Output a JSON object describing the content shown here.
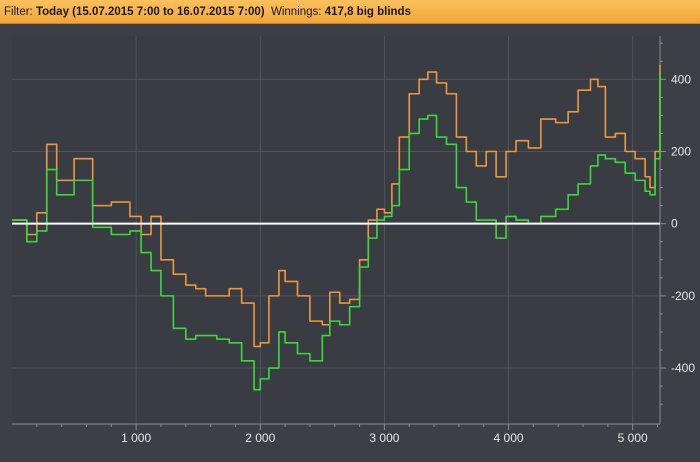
{
  "header": {
    "filter_label": "Filter:",
    "filter_value": "Today (15.07.2015 7:00 to 16.07.2015 7:00)",
    "winnings_label": "Winnings:",
    "winnings_value": "417,8 big blinds"
  },
  "chart_data": {
    "type": "line",
    "x_ticks": [
      1000,
      2000,
      3000,
      4000,
      5000
    ],
    "x_tick_labels": [
      "1 000",
      "2 000",
      "3 000",
      "4 000",
      "5 000"
    ],
    "y_ticks": [
      400,
      200,
      0,
      -200,
      -400
    ],
    "y_tick_labels": [
      "400",
      "200",
      "0",
      "-200",
      "-400"
    ],
    "xlim": [
      0,
      5220
    ],
    "ylim": [
      -555,
      520
    ],
    "grid": true,
    "zero_line": true,
    "series": [
      {
        "color": "#f0963c",
        "x": [
          0,
          120,
          200,
          280,
          360,
          500,
          650,
          800,
          950,
          1040,
          1120,
          1200,
          1300,
          1400,
          1480,
          1560,
          1650,
          1750,
          1850,
          1950,
          2000,
          2070,
          2150,
          2200,
          2300,
          2400,
          2500,
          2560,
          2640,
          2720,
          2800,
          2870,
          2940,
          3000,
          3060,
          3120,
          3200,
          3280,
          3350,
          3420,
          3500,
          3580,
          3660,
          3740,
          3820,
          3900,
          3980,
          4060,
          4160,
          4260,
          4380,
          4480,
          4560,
          4660,
          4720,
          4780,
          4860,
          4940,
          5020,
          5100,
          5140,
          5180,
          5220
        ],
        "y": [
          10,
          -30,
          30,
          220,
          120,
          180,
          50,
          60,
          20,
          -30,
          20,
          -100,
          -140,
          -170,
          -180,
          -200,
          -200,
          -180,
          -220,
          -340,
          -330,
          -200,
          -130,
          -160,
          -200,
          -270,
          -280,
          -190,
          -220,
          -210,
          -100,
          10,
          40,
          30,
          110,
          240,
          360,
          400,
          420,
          390,
          360,
          240,
          200,
          160,
          200,
          130,
          200,
          230,
          210,
          290,
          280,
          310,
          370,
          400,
          380,
          240,
          250,
          200,
          180,
          130,
          100,
          200,
          440
        ]
      },
      {
        "color": "#3dd83d",
        "x": [
          0,
          120,
          200,
          280,
          360,
          500,
          650,
          800,
          950,
          1040,
          1120,
          1200,
          1300,
          1400,
          1480,
          1560,
          1650,
          1750,
          1850,
          1950,
          2000,
          2070,
          2150,
          2200,
          2300,
          2400,
          2500,
          2560,
          2640,
          2720,
          2800,
          2870,
          2940,
          3000,
          3060,
          3120,
          3200,
          3280,
          3350,
          3420,
          3500,
          3580,
          3660,
          3740,
          3820,
          3900,
          3980,
          4060,
          4160,
          4260,
          4380,
          4480,
          4560,
          4660,
          4720,
          4780,
          4860,
          4940,
          5020,
          5100,
          5140,
          5180,
          5220
        ],
        "y": [
          10,
          -50,
          -20,
          150,
          80,
          120,
          -10,
          -30,
          -20,
          -80,
          -130,
          -200,
          -290,
          -320,
          -310,
          -310,
          -320,
          -330,
          -380,
          -460,
          -430,
          -400,
          -300,
          -330,
          -360,
          -380,
          -310,
          -270,
          -280,
          -230,
          -120,
          -40,
          10,
          20,
          50,
          150,
          250,
          290,
          300,
          240,
          220,
          100,
          60,
          10,
          10,
          -40,
          20,
          10,
          0,
          20,
          40,
          80,
          110,
          160,
          190,
          180,
          170,
          140,
          120,
          90,
          80,
          180,
          420
        ]
      }
    ]
  }
}
